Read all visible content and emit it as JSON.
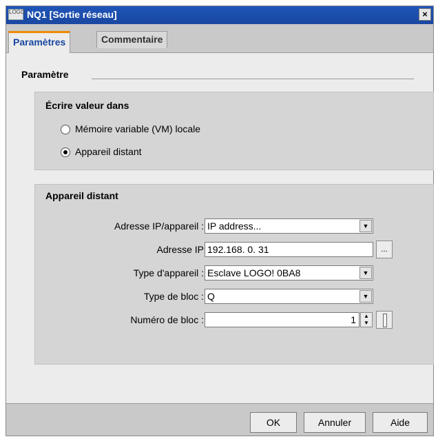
{
  "window": {
    "title": "NQ1 [Sortie réseau]",
    "close_symbol": "×",
    "logo_text": "LOGO"
  },
  "tabs": [
    {
      "label": "Paramètres",
      "active": true
    },
    {
      "label": "Commentaire",
      "active": false
    }
  ],
  "parametre": {
    "section_title": "Paramètre",
    "write_group": {
      "title": "Écrire valeur dans",
      "options": [
        {
          "label": "Mémoire variable (VM) locale",
          "checked": false
        },
        {
          "label": "Appareil distant",
          "checked": true
        }
      ]
    },
    "remote_group": {
      "title": "Appareil distant",
      "address_mode": {
        "label": "Adresse IP/appareil :",
        "value": "IP address..."
      },
      "ip_address": {
        "label": "Adresse IP",
        "value": "192.168.  0. 31",
        "browse_label": "..."
      },
      "device_type": {
        "label": "Type d'appareil :",
        "value": "Esclave LOGO! 0BA8"
      },
      "block_type": {
        "label": "Type de bloc :",
        "value": "Q"
      },
      "block_number": {
        "label": "Numéro de bloc :",
        "value": "1"
      }
    }
  },
  "footer": {
    "ok_label": "OK",
    "cancel_label": "Annuler",
    "help_label": "Aide"
  },
  "colors": {
    "titlebar": "#1a47a0",
    "active_tab_text": "#1746a0",
    "active_tab_accent": "#f08a00"
  },
  "icons": {
    "dropdown": "chevron-down-icon",
    "spinner": "spinner-arrows-icon",
    "close": "close-icon"
  }
}
